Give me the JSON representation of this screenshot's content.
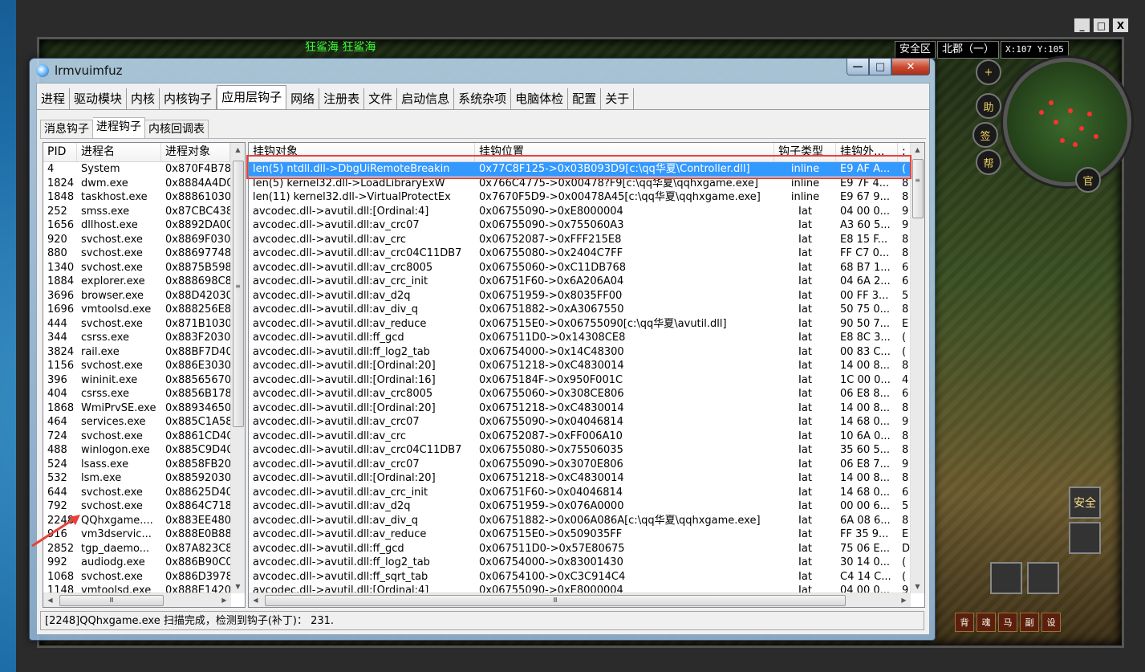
{
  "game": {
    "caption": "狂鲨海  狂鲨海",
    "controls": [
      "_",
      "□",
      "X"
    ],
    "hud": {
      "zone": "安全区",
      "map": "北郡（一）",
      "coord": "X:107  Y:105"
    },
    "minimap_buttons": [
      "+",
      "助",
      "签",
      "帮",
      "官"
    ],
    "side_buttons": [
      "安全"
    ],
    "bottom_buttons": [
      "背",
      "魂",
      "马",
      "副",
      "设"
    ]
  },
  "window": {
    "title": "lrmvuimfuz",
    "controls": {
      "minimize": "—",
      "maximize": "□",
      "close": "✕"
    }
  },
  "tabs_main": [
    {
      "label": "进程",
      "active": false
    },
    {
      "label": "驱动模块",
      "active": false
    },
    {
      "label": "内核",
      "active": false
    },
    {
      "label": "内核钩子",
      "active": false
    },
    {
      "label": "应用层钩子",
      "active": true
    },
    {
      "label": "网络",
      "active": false
    },
    {
      "label": "注册表",
      "active": false
    },
    {
      "label": "文件",
      "active": false
    },
    {
      "label": "启动信息",
      "active": false
    },
    {
      "label": "系统杂项",
      "active": false
    },
    {
      "label": "电脑体检",
      "active": false
    },
    {
      "label": "配置",
      "active": false
    },
    {
      "label": "关于",
      "active": false
    }
  ],
  "tabs_sub": [
    {
      "label": "消息钩子",
      "active": false
    },
    {
      "label": "进程钩子",
      "active": true
    },
    {
      "label": "内核回调表",
      "active": false
    }
  ],
  "process_list": {
    "columns": [
      "PID",
      "进程名",
      "进程对象"
    ],
    "rows": [
      [
        "4",
        "System",
        "0x870F4B78"
      ],
      [
        "1824",
        "dwm.exe",
        "0x8884A4D0"
      ],
      [
        "1848",
        "taskhost.exe",
        "0x88861030"
      ],
      [
        "252",
        "smss.exe",
        "0x87CBC438"
      ],
      [
        "1656",
        "dllhost.exe",
        "0x8892DA00"
      ],
      [
        "920",
        "svchost.exe",
        "0x8869F030"
      ],
      [
        "880",
        "svchost.exe",
        "0x88697748"
      ],
      [
        "1340",
        "svchost.exe",
        "0x8875B598"
      ],
      [
        "1884",
        "explorer.exe",
        "0x888698C8"
      ],
      [
        "3696",
        "browser.exe",
        "0x88D42030"
      ],
      [
        "1696",
        "vmtoolsd.exe",
        "0x888256E8"
      ],
      [
        "444",
        "svchost.exe",
        "0x871B1030"
      ],
      [
        "344",
        "csrss.exe",
        "0x883F2030"
      ],
      [
        "3824",
        "rail.exe",
        "0x88BF7D40"
      ],
      [
        "1156",
        "svchost.exe",
        "0x886E3030"
      ],
      [
        "396",
        "wininit.exe",
        "0x88565670"
      ],
      [
        "404",
        "csrss.exe",
        "0x8856B178"
      ],
      [
        "1868",
        "WmiPrvSE.exe",
        "0x88934650"
      ],
      [
        "464",
        "services.exe",
        "0x885C1A58"
      ],
      [
        "724",
        "svchost.exe",
        "0x8861CD40"
      ],
      [
        "488",
        "winlogon.exe",
        "0x885C9D40"
      ],
      [
        "524",
        "lsass.exe",
        "0x8858FB20"
      ],
      [
        "532",
        "lsm.exe",
        "0x88592030"
      ],
      [
        "644",
        "svchost.exe",
        "0x88625D40"
      ],
      [
        "792",
        "svchost.exe",
        "0x8864C718"
      ],
      [
        "2248",
        "QQhxgame....",
        "0x883EE480"
      ],
      [
        "916",
        "vm3dservic...",
        "0x888E0B88"
      ],
      [
        "2852",
        "tgp_daemo...",
        "0x87A823C8"
      ],
      [
        "992",
        "audiodg.exe",
        "0x886B90C0"
      ],
      [
        "1068",
        "svchost.exe",
        "0x886D3978"
      ],
      [
        "1148",
        "vmtoolsd.exe",
        "0x888E1420"
      ]
    ]
  },
  "hook_list": {
    "columns": [
      "挂钩对象",
      "挂钩位置",
      "钩子类型",
      "挂钩外...",
      ";"
    ],
    "rows": [
      [
        "len(5) ntdll.dll->DbgUiRemoteBreakin",
        "0x77C8F125->0x03B093D9[c:\\qq华夏\\Controller.dll]",
        "inline",
        "E9 AF A...",
        "("
      ],
      [
        "len(5) kernel32.dll->LoadLibraryExW",
        "0x766C4775->0x00478?F9[c:\\qq华夏\\qqhxgame.exe]",
        "inline",
        "E9 7F 4...",
        "8"
      ],
      [
        "len(11) kernel32.dll->VirtualProtectEx",
        "0x7670F5D9->0x00478A45[c:\\qq华夏\\qqhxgame.exe]",
        "inline",
        "E9 67 9...",
        "8"
      ],
      [
        "avcodec.dll->avutil.dll:[Ordinal:4]",
        "0x06755090->0xE8000004",
        "Iat",
        "04 00 0...",
        "9"
      ],
      [
        "avcodec.dll->avutil.dll:av_crc07",
        "0x06755090->0x755060A3",
        "Iat",
        "A3 60 5...",
        "9"
      ],
      [
        "avcodec.dll->avutil.dll:av_crc",
        "0x06752087->0xFFF215E8",
        "Iat",
        "E8 15 F...",
        "8"
      ],
      [
        "avcodec.dll->avutil.dll:av_crc04C11DB7",
        "0x06755080->0x2404C7FF",
        "Iat",
        "FF C7 0...",
        "8"
      ],
      [
        "avcodec.dll->avutil.dll:av_crc8005",
        "0x06755060->0xC11DB768",
        "Iat",
        "68 B7 1...",
        "6"
      ],
      [
        "avcodec.dll->avutil.dll:av_crc_init",
        "0x06751F60->0x6A206A04",
        "Iat",
        "04 6A 2...",
        "6"
      ],
      [
        "avcodec.dll->avutil.dll:av_d2q",
        "0x06751959->0x8035FF00",
        "Iat",
        "00 FF 3...",
        "5"
      ],
      [
        "avcodec.dll->avutil.dll:av_div_q",
        "0x06751882->0xA3067550",
        "Iat",
        "50 75 0...",
        "8"
      ],
      [
        "avcodec.dll->avutil.dll:av_reduce",
        "0x067515E0->0x06755090[c:\\qq华夏\\avutil.dll]",
        "Iat",
        "90 50 7...",
        "E"
      ],
      [
        "avcodec.dll->avutil.dll:ff_gcd",
        "0x067511D0->0x14308CE8",
        "Iat",
        "E8 8C 3...",
        "("
      ],
      [
        "avcodec.dll->avutil.dll:ff_log2_tab",
        "0x06754000->0x14C48300",
        "Iat",
        "00 83 C...",
        "("
      ],
      [
        "avcodec.dll->avutil.dll:[Ordinal:20]",
        "0x06751218->0xC4830014",
        "Iat",
        "14 00 8...",
        "8"
      ],
      [
        "avcodec.dll->avutil.dll:[Ordinal:16]",
        "0x0675184F->0x950F001C",
        "Iat",
        "1C 00 0...",
        "4"
      ],
      [
        "avcodec.dll->avutil.dll:av_crc8005",
        "0x06755060->0x308CE806",
        "Iat",
        "06 E8 8...",
        "6"
      ],
      [
        "avcodec.dll->avutil.dll:[Ordinal:20]",
        "0x06751218->0xC4830014",
        "Iat",
        "14 00 8...",
        "8"
      ],
      [
        "avcodec.dll->avutil.dll:av_crc07",
        "0x06755090->0x04046814",
        "Iat",
        "14 68 0...",
        "9"
      ],
      [
        "avcodec.dll->avutil.dll:av_crc",
        "0x06752087->0xFF006A10",
        "Iat",
        "10 6A 0...",
        "8"
      ],
      [
        "avcodec.dll->avutil.dll:av_crc04C11DB7",
        "0x06755080->0x75506035",
        "Iat",
        "35 60 5...",
        "8"
      ],
      [
        "avcodec.dll->avutil.dll:av_crc07",
        "0x06755090->0x3070E806",
        "Iat",
        "06 E8 7...",
        "9"
      ],
      [
        "avcodec.dll->avutil.dll:[Ordinal:20]",
        "0x06751218->0xC4830014",
        "Iat",
        "14 00 8...",
        "8"
      ],
      [
        "avcodec.dll->avutil.dll:av_crc_init",
        "0x06751F60->0x04046814",
        "Iat",
        "14 68 0...",
        "6"
      ],
      [
        "avcodec.dll->avutil.dll:av_d2q",
        "0x06751959->0x076A0000",
        "Iat",
        "00 00 6...",
        "5"
      ],
      [
        "avcodec.dll->avutil.dll:av_div_q",
        "0x06751882->0x006A086A[c:\\qq华夏\\qqhxgame.exe]",
        "Iat",
        "6A 08 6...",
        "8"
      ],
      [
        "avcodec.dll->avutil.dll:av_reduce",
        "0x067515E0->0x509035FF",
        "Iat",
        "FF 35 9...",
        "E"
      ],
      [
        "avcodec.dll->avutil.dll:ff_gcd",
        "0x067511D0->0x57E80675",
        "Iat",
        "75 06 E...",
        "D"
      ],
      [
        "avcodec.dll->avutil.dll:ff_log2_tab",
        "0x06754000->0x83001430",
        "Iat",
        "30 14 0...",
        "("
      ],
      [
        "avcodec.dll->avutil.dll:ff_sqrt_tab",
        "0x06754100->0xC3C914C4",
        "Iat",
        "C4 14 C...",
        "("
      ],
      [
        "avcodec.dll->avutil.dll:[Ordinal:4]",
        "0x06755090->0xE8000004",
        "Iat",
        "04 00 0...",
        "9"
      ]
    ]
  },
  "scroll_glyphs": {
    "up": "▲",
    "down": "▼",
    "left": "◀",
    "right": "▶",
    "grip": "≡",
    "hgrip": "Ⅲ"
  },
  "status": {
    "text": "[2248]QQhxgame.exe 扫描完成，检测到钩子(补丁)：  231."
  },
  "colors": {
    "selection": "#3399ff",
    "annotation": "#e8413a"
  }
}
